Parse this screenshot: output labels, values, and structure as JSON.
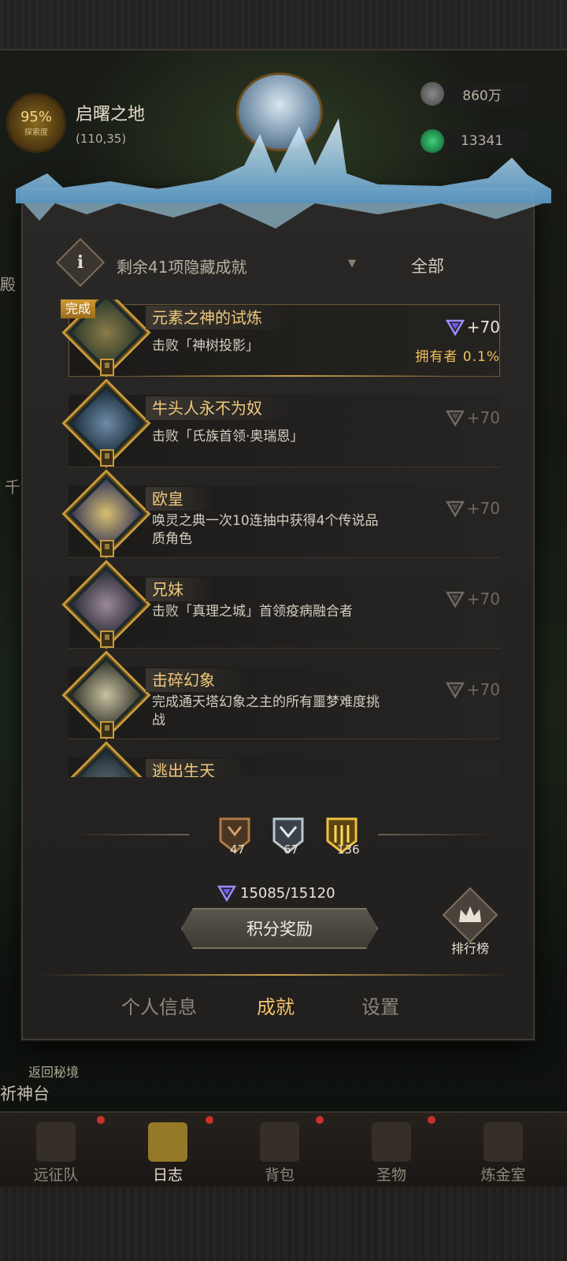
{
  "region": {
    "explore_percent": "95%",
    "explore_label": "探索度",
    "name": "启曙之地",
    "coords": "(110,35)"
  },
  "resources": {
    "silver": "860万",
    "gems": "13341"
  },
  "side_labels": {
    "left_char": "殿",
    "left_char2": "千"
  },
  "filter": {
    "hidden_label": "剩余41项隐藏成就",
    "all_label": "全部"
  },
  "achievements": [
    {
      "title": "元素之神的试炼",
      "desc": "击败「神树投影」",
      "reward": "+70",
      "completed": true,
      "done_label": "完成",
      "owner": "拥有者  0.1%"
    },
    {
      "title": "牛头人永不为奴",
      "desc": "击败「氏族首领·奥瑞恩」",
      "reward": "+70",
      "completed": false
    },
    {
      "title": "欧皇",
      "desc": "唤灵之典一次10连抽中获得4个传说品质角色",
      "reward": "+70",
      "completed": false
    },
    {
      "title": "兄妹",
      "desc": "击败「真理之城」首领疫病融合者",
      "reward": "+70",
      "completed": false
    },
    {
      "title": "击碎幻象",
      "desc": "完成通天塔幻象之主的所有噩梦难度挑战",
      "reward": "+70",
      "completed": false
    },
    {
      "title": "逃出生天",
      "desc": "",
      "reward": "",
      "completed": false
    }
  ],
  "stats": {
    "bronze": "47",
    "silver": "67",
    "gold": "136"
  },
  "progress": "15085/15120",
  "reward_button": "积分奖励",
  "ranking_label": "排行榜",
  "tabs": [
    "个人信息",
    "成就",
    "设置"
  ],
  "active_tab": "成就",
  "return_label": "返回秘境",
  "shrine_label": "祈神台",
  "bottom_nav": [
    "远征队",
    "日志",
    "背包",
    "圣物",
    "炼金室"
  ],
  "active_nav": "日志",
  "colors": {
    "gold_text": "#efc97e",
    "active_tab": "#f1c26b",
    "owner_text": "#f2c15a",
    "notification_dot": "#c8322a"
  }
}
